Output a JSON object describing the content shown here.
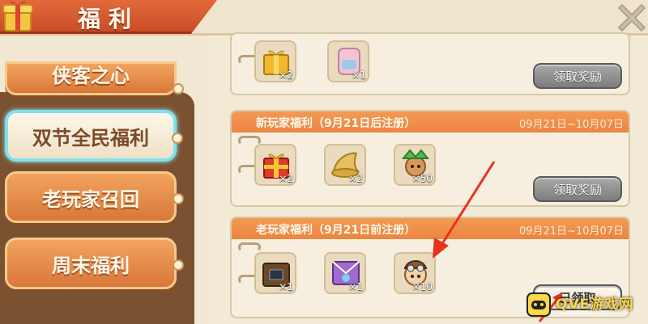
{
  "header": {
    "title": "福利",
    "gift_icon": "gift-box-icon",
    "close_icon": "close-x-icon"
  },
  "sidebar": {
    "tabs": [
      {
        "label": "侠客之心",
        "active": false
      },
      {
        "label": "双节全民福利",
        "active": true
      },
      {
        "label": "老玩家召回",
        "active": false
      },
      {
        "label": "周末福利",
        "active": false
      }
    ]
  },
  "rewards": [
    {
      "title": "",
      "date": "",
      "items": [
        {
          "icon": "gold-gift-box-icon",
          "qty": "×2"
        },
        {
          "icon": "pink-backpack-icon",
          "qty": "×1"
        }
      ],
      "button": "领取奖励",
      "claimed": false
    },
    {
      "title": "新玩家福利（9月21日后注册）",
      "date": "09月21日~10月07日",
      "items": [
        {
          "icon": "red-gift-box-icon",
          "qty": "×2"
        },
        {
          "icon": "gold-hat-icon",
          "qty": "×2"
        },
        {
          "icon": "green-character-icon",
          "qty": "×50"
        }
      ],
      "button": "领取奖励",
      "claimed": false
    },
    {
      "title": "老玩家福利（9月21日前注册）",
      "date": "09月21日~10月07日",
      "items": [
        {
          "icon": "wooden-chest-icon",
          "qty": "×1"
        },
        {
          "icon": "envelope-card-icon",
          "qty": "×1"
        },
        {
          "icon": "aviator-character-icon",
          "qty": "×10"
        }
      ],
      "button": "已领取",
      "claimed": true
    }
  ],
  "watermark": {
    "text": "QVE游戏网",
    "sub": "www.qqe.com"
  },
  "colors": {
    "accent_orange": "#ec8540",
    "active_tab_glow": "#7fe0ee",
    "annotation_arrow": "#e8321c"
  }
}
